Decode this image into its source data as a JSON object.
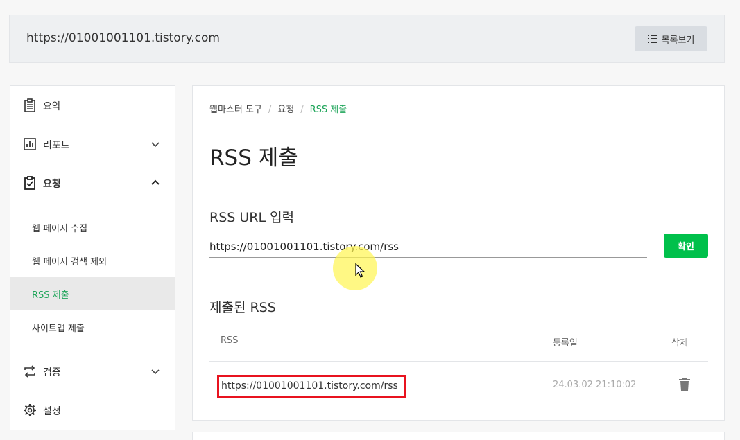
{
  "site": {
    "url": "https://01001001101.tistory.com",
    "list_button": "목록보기"
  },
  "sidebar": {
    "items": [
      {
        "label": "요약",
        "icon": "clipboard-icon"
      },
      {
        "label": "리포트",
        "icon": "chart-icon"
      },
      {
        "label": "요청",
        "icon": "clipboard-check-icon"
      },
      {
        "label": "검증",
        "icon": "repeat-icon"
      },
      {
        "label": "설정",
        "icon": "gear-icon"
      }
    ],
    "sub_items": [
      {
        "label": "웹 페이지 수집"
      },
      {
        "label": "웹 페이지 검색 제외"
      },
      {
        "label": "RSS 제출"
      },
      {
        "label": "사이트맵 제출"
      }
    ]
  },
  "breadcrumb": {
    "items": [
      "웹마스터 도구",
      "요청",
      "RSS 제출"
    ]
  },
  "page": {
    "title": "RSS 제출",
    "input_section_title": "RSS URL 입력",
    "input_value": "https://01001001101.tistory.com/rss",
    "confirm_button": "확인",
    "submitted_title": "제출된 RSS"
  },
  "table": {
    "columns": [
      "RSS",
      "등록일",
      "삭제"
    ],
    "rows": [
      {
        "rss": "https://01001001101.tistory.com/rss",
        "date": "24.03.02 21:10:02"
      }
    ]
  },
  "colors": {
    "accent": "#00c04b",
    "highlight_box": "#e8131f"
  }
}
